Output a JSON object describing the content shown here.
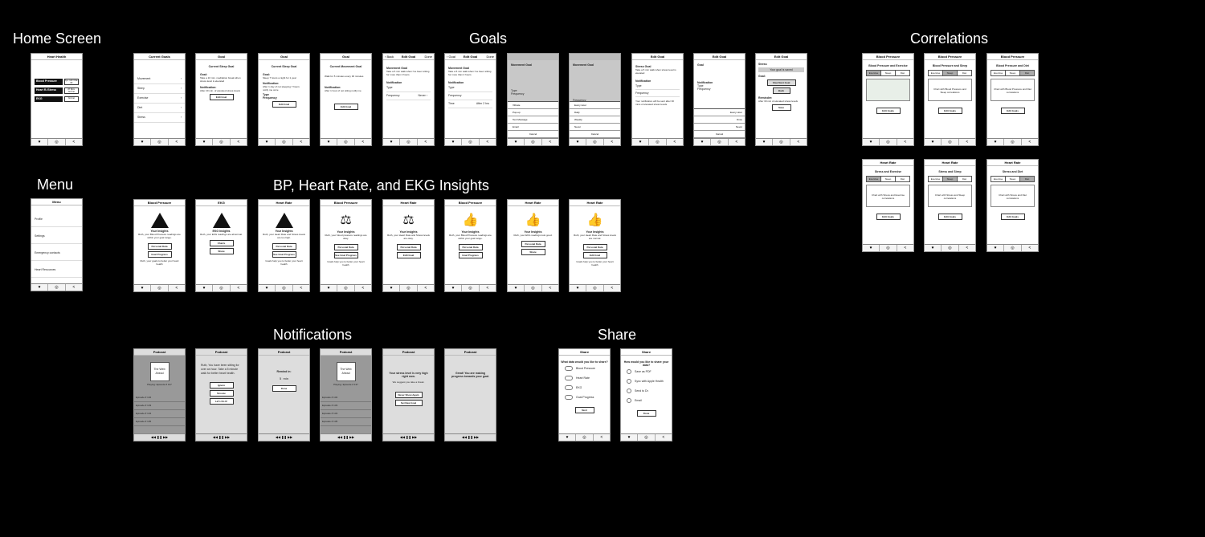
{
  "sections": {
    "home": "Home Screen",
    "goals": "Goals",
    "correlations": "Correlations",
    "menu": "Menu",
    "insights": "BP, Heart Rate, and EKG  Insights",
    "notifications": "Notifications",
    "share": "Share"
  },
  "tabbar": [
    "♥",
    "◎",
    "<"
  ],
  "home": {
    "title": "Heart Health",
    "items": [
      {
        "label": "Blood Pressure",
        "value": "Sys: 120 / Dia: 80"
      },
      {
        "label": "Heart R./Stress",
        "value": "87 Bpm Normal"
      },
      {
        "label": "EKG",
        "value": "Normal"
      }
    ]
  },
  "menu": {
    "title": "Menu",
    "items": [
      "Profile",
      "Settings",
      "Emergency contacts",
      "Heart Resources",
      "Tutorial"
    ]
  },
  "goals": {
    "current": {
      "title": "Current Goals",
      "items": [
        "Movement",
        "Sleep",
        "Exercise",
        "Diet",
        "Stress"
      ]
    },
    "sleep_goal": {
      "title": "Goal",
      "heading": "Current Sleep Goal",
      "goal_label": "Goal:",
      "goal_text": "Take a 10 min. meditation break when stress level is elevated",
      "notif_label": "Notification:",
      "notif_text": "After 20 min. of elevated stress levels",
      "button": "Edit Goal"
    },
    "sleep_goal2": {
      "title": "Goal",
      "heading": "Current Sleep Goal",
      "goal_label": "Goal:",
      "goal_text": "Sleep 7 hours a night for 1 year",
      "notif_label": "Notification:",
      "notif_text": "After 1 day of not sleeping 7 hours notify me once",
      "type_label": "Type",
      "freq_label": "Frequency",
      "button": "Edit Goal"
    },
    "movement_goal": {
      "title": "Goal",
      "heading": "Current Movement Goal",
      "goal_text": "Walk for 5 minutes every 30 minutes",
      "notif_label": "Notification:",
      "notif_text": "After 1 hour of not sitting notify me",
      "button": "Edit Goal"
    },
    "edit1": {
      "back": "‹ Back",
      "title": "Edit Goal",
      "done": "Done",
      "heading": "Movement Goal",
      "goal_text": "Take a 5 min walk when I've been sitting for more than 2 hours",
      "notif_label": "Notification",
      "type_label": "Type",
      "freq_label": "Frequency",
      "freq_value": "Never ›"
    },
    "edit2": {
      "back": "‹ Goal",
      "title": "Edit Goal",
      "done": "Done",
      "heading": "Movement Goal",
      "goal_text": "Take a 5 min walk when I've been sitting for more than 2 hours",
      "notif_label": "Notification",
      "type_label": "Type",
      "freq_label": "Frequency",
      "time_label": "Time",
      "time_value": "After 2 hrs"
    },
    "edit3": {
      "heading": "Movement Goal",
      "type_label": "Type",
      "freq_label": "Frequency",
      "options": [
        "Vibrate",
        "Pop-up",
        "Text Message",
        "Email"
      ],
      "cancel": "Cancel"
    },
    "edit4": {
      "heading": "Movement Goal",
      "freq_label": "Frequency",
      "options": [
        "Every Hour",
        "Daily",
        "Weekly",
        "Never"
      ],
      "cancel": "Cancel"
    },
    "edit5": {
      "title": "Edit Goal",
      "heading": "Stress Goal",
      "goal_text": "Take a 5 min walk when stress level is elevated",
      "notif_label": "Notification",
      "type_label": "Type",
      "freq_label": "Frequency",
      "note": "Your notification will be sent after 30 mins of elevated stress levels."
    },
    "edit6": {
      "title": "Edit Goal",
      "heading": "Goal",
      "notif_label": "Notification",
      "type_label": "Type",
      "freq_label": "Frequency",
      "options": [
        "Every Hour",
        "Once",
        "Never"
      ],
      "cancel": "Cancel"
    },
    "saved": {
      "title": "Edit Goal",
      "heading": "Stress",
      "saved_text": "Your goal is saved",
      "goal_label": "Goal:",
      "view_button": "View Next Goal",
      "back_button": "Back",
      "reminder_label": "Reminder:",
      "reminder_text": "After 30 min of elevated stress levels",
      "save_button": "Save"
    }
  },
  "correlations": {
    "seg_options": [
      "Exercise",
      "Sleep",
      "Diet"
    ],
    "button": "Edit Goals",
    "screens": [
      {
        "title": "Blood Pressure",
        "heading": "Blood Pressure and Exercise",
        "active": 0,
        "chart": ""
      },
      {
        "title": "Blood Pressure",
        "heading": "Blood Pressure and Sleep",
        "active": 1,
        "chart": "Chart with Blood Pressure and Sleep correlations"
      },
      {
        "title": "Blood Pressure",
        "heading": "Blood Pressure and Diet",
        "active": 2,
        "chart": "Chart with Blood Pressure and Diet correlations"
      },
      {
        "title": "Heart Rate",
        "heading": "Stress and Exercise",
        "active": 0,
        "chart": "Chart with Stress and Exercise correlations"
      },
      {
        "title": "Heart Rate",
        "heading": "Stress and Sleep",
        "active": 1,
        "chart": "Chart with Stress and Sleep correlations"
      },
      {
        "title": "Heart Rate",
        "heading": "Stress and Diet",
        "active": 2,
        "chart": "Chart with Stress and Diet correlations"
      }
    ]
  },
  "insights": [
    {
      "title": "Blood Pressure",
      "icon": "warning",
      "heading": "Your Insights",
      "text": "Ruth, your Blood Pressure readings are within your goal range.",
      "b1": "Personal Data",
      "b2": "Goal Progress",
      "foot": "Ruth, your goals to better your heart health"
    },
    {
      "title": "EKG",
      "icon": "warning",
      "heading": "EKG Insights",
      "text": "Ruth, your EKG readings are abnormal.",
      "b1": "Charts",
      "b2": "Share",
      "foot": ""
    },
    {
      "title": "Heart Rate",
      "icon": "warning",
      "heading": "Your Insights",
      "text": "Ruth, your Heart Rate and Stress levels are too high.",
      "b1": "Personal Data",
      "b2": "See Goal Progress",
      "foot": "Goals help you to better your heart health"
    },
    {
      "title": "Blood Pressure",
      "icon": "scale",
      "heading": "Your Insights",
      "text": "Ruth, your blood pressure readings are okay.",
      "b1": "Personal Data",
      "b2": "See Goal Progress",
      "foot": "Goals help you to better your heart health"
    },
    {
      "title": "Heart Rate",
      "icon": "scale",
      "heading": "Your Insights",
      "text": "Ruth, your Heart Rate and Stress levels are okay.",
      "b1": "Personal Data",
      "b2": "Edit Goal",
      "foot": ""
    },
    {
      "title": "Blood Pressure",
      "icon": "thumb",
      "heading": "Your Insights",
      "text": "Ruth, your Blood Pressure readings are within your goal range.",
      "b1": "Personal Data",
      "b2": "Goal Progress",
      "foot": ""
    },
    {
      "title": "Heart Rate",
      "icon": "thumb",
      "heading": "Your Insights",
      "text": "Ruth, your EKG readings look good.",
      "b1": "Personal Data",
      "b2": "Share",
      "foot": ""
    },
    {
      "title": "Heart Rate",
      "icon": "thumb",
      "heading": "Your Insights",
      "text": "Ruth, your Heart Rate and Stress levels are normal.",
      "b1": "Personal Data",
      "b2": "Edit Goal",
      "foot": "Goals help you to better your heart health"
    }
  ],
  "notifications": {
    "podcast_title": "Podcast",
    "art_text": "The Web Ahead",
    "playing": "Playing: Episode # 137",
    "episodes": [
      "Episode # 132",
      "Episode # 133",
      "Episode # 134",
      "Episode # 135"
    ],
    "now": "Episode # 136",
    "player": "◀◀  ❚❚  ▶▶",
    "n2": {
      "text": "Ruth, You have been sitting for over an hour. Take a 5 minute walk for better heart health.",
      "b1": "Ignore",
      "b2": "Snooze",
      "b3": "Let's Do It!"
    },
    "n3": {
      "label": "Remind in:",
      "value": "5",
      "unit": "min",
      "b1": "Done"
    },
    "n5": {
      "text": "Your stress level is very high right now.",
      "sub": "We suggest you take a break.",
      "b1": "Never Show Again",
      "b2": "Set New Goal"
    },
    "n6": {
      "text": "Great! You are making progress towards your goal."
    }
  },
  "share": {
    "title": "Share",
    "s1": {
      "question": "What data would you like to share?",
      "items": [
        "Blood Pressure",
        "Heart Rate",
        "EKG",
        "Goal Progress"
      ],
      "button": "Next"
    },
    "s2": {
      "question": "How would you like to share your data?",
      "items": [
        "Save as PDF",
        "Sync with Apple Health",
        "Send to Dr.",
        "Email"
      ],
      "button": "Done"
    }
  }
}
